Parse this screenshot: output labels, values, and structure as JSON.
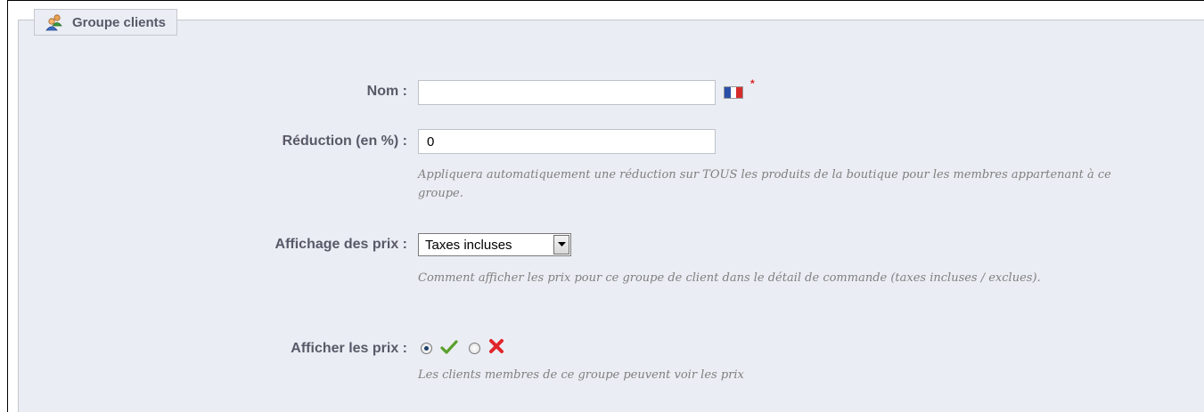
{
  "legend": {
    "title": "Groupe clients",
    "icon": "user-group-icon"
  },
  "fields": {
    "nom": {
      "label": "Nom :",
      "value": "",
      "flag_icon": "france-flag-icon",
      "required_marker": "*"
    },
    "reduction": {
      "label": "Réduction (en %) :",
      "value": "0",
      "hint": "Appliquera automatiquement une réduction sur TOUS les produits de la boutique pour les membres appartenant à ce groupe."
    },
    "affichage": {
      "label": "Affichage des prix :",
      "selected": "Taxes incluses",
      "hint": "Comment afficher les prix pour ce groupe de client dans le détail de commande (taxes incluses / exclues)."
    },
    "afficher": {
      "label": "Afficher les prix :",
      "options": [
        {
          "icon": "check-icon",
          "checked": true
        },
        {
          "icon": "cross-icon",
          "checked": false
        }
      ],
      "hint": "Les clients membres de ce groupe peuvent voir les prix"
    }
  },
  "colors": {
    "background": "#ebedf4",
    "label": "#585a69",
    "hint": "#7f7f7f",
    "check": "#5aa02c",
    "cross": "#e0262c"
  }
}
